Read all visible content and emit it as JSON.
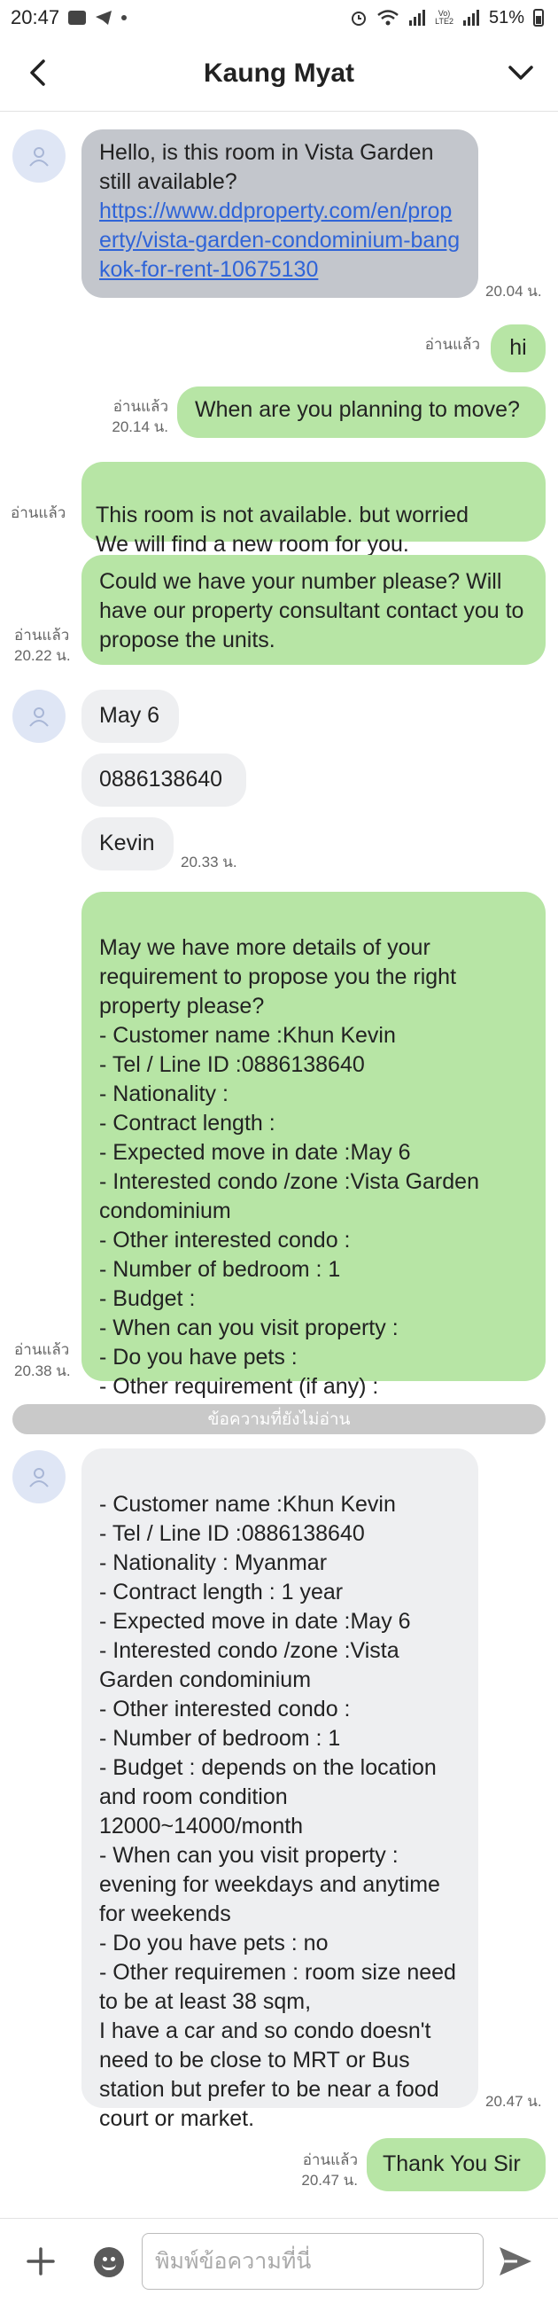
{
  "status_bar": {
    "time": "20:47",
    "battery": "51%",
    "icons": [
      "gallery-icon",
      "telegram-icon",
      "dot-icon",
      "alarm-icon",
      "wifi-icon",
      "signal-icon",
      "volte-icon",
      "battery-icon"
    ]
  },
  "header": {
    "title": "Kaung Myat",
    "back_icon": "chevron-left-icon",
    "menu_icon": "chevron-down-icon"
  },
  "messages": [
    {
      "side": "in",
      "text": "Hello, is this room in Vista Garden still available?",
      "link": "https://www.ddproperty.com/en/property/vista-garden-condominium-bangkok-for-rent-10675130",
      "time": "20.04 น."
    },
    {
      "side": "out",
      "text": "hi",
      "read": "อ่านแล้ว"
    },
    {
      "side": "out",
      "text": "When are you planning to move?",
      "read": "อ่านแล้ว",
      "time": "20.14 น."
    },
    {
      "side": "out",
      "text": "This room is not available.  but worried\n We will find a new room for you.",
      "read": "อ่านแล้ว"
    },
    {
      "side": "out",
      "text": "Could we have your number please? Will have our property consultant contact you to propose the units.",
      "read": "อ่านแล้ว",
      "time": "20.22 น."
    },
    {
      "side": "in",
      "text": "May 6"
    },
    {
      "side": "in",
      "text": "0886138640"
    },
    {
      "side": "in",
      "text": "Kevin",
      "time": "20.33 น."
    },
    {
      "side": "out",
      "text": "May we have more details of your requirement to propose you the right property please?\n- Customer name :Khun Kevin\n- Tel / Line ID :0886138640\n- Nationality :\n- Contract length :\n- Expected move in date :May 6\n- Interested condo /zone :Vista Garden condominium\n- Other interested condo :\n- Number of bedroom  : 1\n- Budget :\n- When can you visit property :\n- Do you have pets :\n- Other requirement (if any) :",
      "read": "อ่านแล้ว",
      "time": "20.38 น."
    },
    {
      "side": "in",
      "text": "- Customer name :Khun Kevin\n- Tel / Line ID :0886138640\n- Nationality : Myanmar\n- Contract length : 1 year\n- Expected move in date :May 6\n- Interested condo /zone :Vista Garden condominium\n- Other interested condo :\n- Number of bedroom  : 1\n- Budget : depends on the location and room condition 12000~14000/month\n- When can you visit property : evening for weekdays and anytime for weekends\n- Do you have pets : no\n- Other requiremen : room size need to be at least 38 sqm,\nI have a car and so condo doesn't need to be close to MRT or Bus station but prefer to be near a food court or market.",
      "time": "20.47 น."
    },
    {
      "side": "out",
      "text": "Thank You Sir",
      "read": "อ่านแล้ว",
      "time": "20.47 น."
    }
  ],
  "unread_divider": "ข้อความที่ยังไม่อ่าน",
  "input": {
    "placeholder": "พิมพ์ข้อความที่นี่",
    "value": ""
  }
}
